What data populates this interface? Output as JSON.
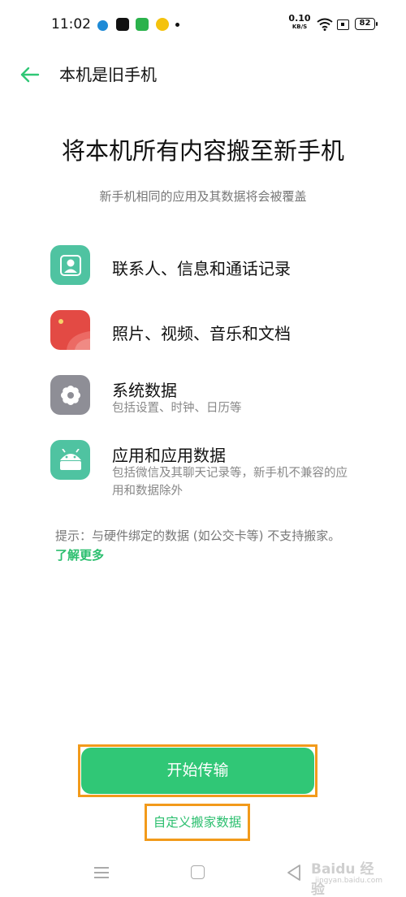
{
  "status_bar": {
    "time": "11:02",
    "net_speed_value": "0.10",
    "net_speed_unit": "KB/S",
    "battery": "82",
    "icons": [
      "notification-blue-dot-icon",
      "notification-app-icon",
      "notification-tv-icon",
      "notification-smiley-icon",
      "wifi-icon",
      "sim-icon",
      "battery-icon"
    ]
  },
  "app_bar": {
    "back_icon": "back-arrow-icon",
    "title": "本机是旧手机"
  },
  "main": {
    "headline": "将本机所有内容搬至新手机",
    "subhead": "新手机相同的应用及其数据将会被覆盖",
    "items": [
      {
        "icon": "contacts-icon",
        "color": "#4fc3a1",
        "title": "联系人、信息和通话记录",
        "desc": ""
      },
      {
        "icon": "photos-icon",
        "color": "#e34a44",
        "title": "照片、视频、音乐和文档",
        "desc": ""
      },
      {
        "icon": "system-gear-icon",
        "color": "#8e8e96",
        "title": "系统数据",
        "desc": "包括设置、时钟、日历等"
      },
      {
        "icon": "android-app-icon",
        "color": "#4fc3a1",
        "title": "应用和应用数据",
        "desc": "包括微信及其聊天记录等，新手机不兼容的应用和数据除外"
      }
    ],
    "tip_text": "提示：与硬件绑定的数据 (如公交卡等) 不支持搬家。",
    "tip_link": "了解更多"
  },
  "actions": {
    "start_label": "开始传输",
    "custom_label": "自定义搬家数据"
  },
  "nav_bar": {
    "icons": [
      "menu-icon",
      "home-icon",
      "back-triangle-icon"
    ]
  },
  "watermark": {
    "main": "Baidu 经验",
    "sub": "jingyan.baidu.com"
  },
  "colors": {
    "accent": "#30c776",
    "link": "#2cbf6f",
    "highlight_frame": "#f29a1b"
  }
}
